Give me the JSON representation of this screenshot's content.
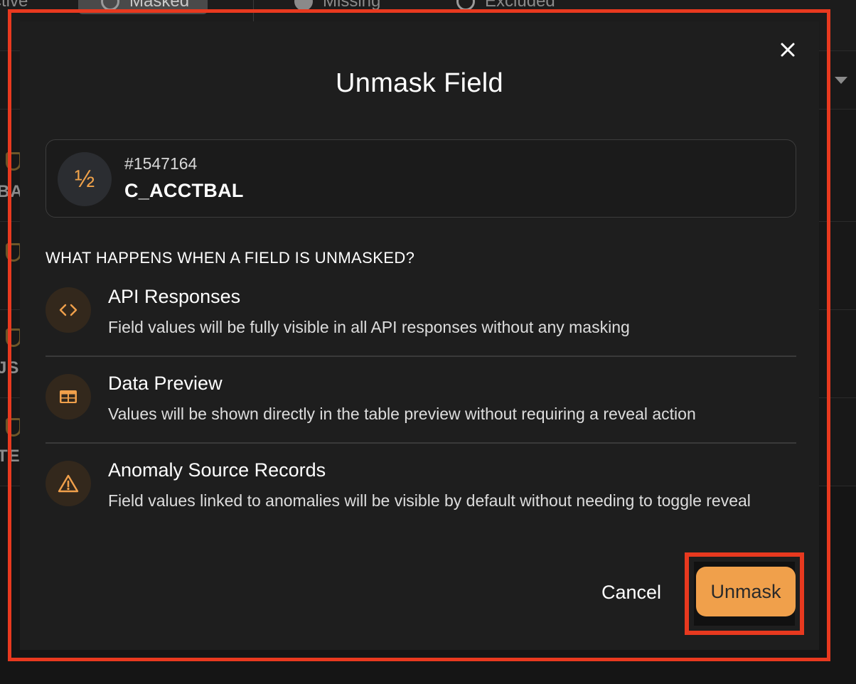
{
  "background": {
    "tabs": [
      {
        "label": "Active",
        "visible_text": "ctive"
      },
      {
        "label": "Masked"
      },
      {
        "label": "Missing"
      },
      {
        "label": "Excluded"
      }
    ],
    "rows": [
      {
        "partial_text": "BA"
      },
      {
        "partial_text": ""
      },
      {
        "partial_text": "JS"
      },
      {
        "partial_text": "TE"
      }
    ]
  },
  "dialog": {
    "title": "Unmask Field",
    "close_icon": "close-icon",
    "field": {
      "icon": "½",
      "id": "#1547164",
      "name": "C_ACCTBAL"
    },
    "section_heading": "WHAT HAPPENS WHEN A FIELD IS UNMASKED?",
    "items": [
      {
        "icon": "code-icon",
        "title": "API Responses",
        "description": "Field values will be fully visible in all API responses without any masking"
      },
      {
        "icon": "table-icon",
        "title": "Data Preview",
        "description": "Values will be shown directly in the table preview without requiring a reveal action"
      },
      {
        "icon": "warning-icon",
        "title": "Anomaly Source Records",
        "description": "Field values linked to anomalies will be visible by default without needing to toggle reveal"
      }
    ],
    "cancel_label": "Cancel",
    "confirm_label": "Unmask"
  },
  "colors": {
    "accent": "#f0a04b",
    "highlight": "#e8391f",
    "dialog_bg": "#1e1e1e"
  }
}
